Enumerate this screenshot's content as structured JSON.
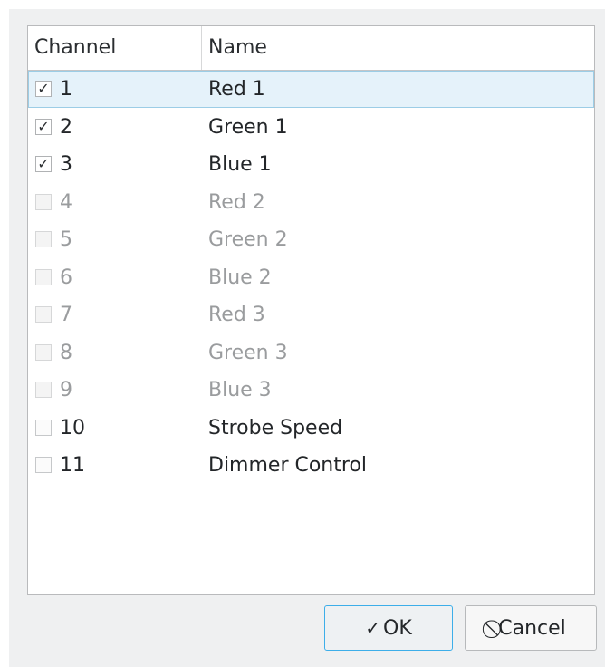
{
  "table": {
    "headers": [
      "Channel",
      "Name"
    ],
    "rows": [
      {
        "checked": true,
        "channel": "1",
        "name": "Red 1",
        "enabled": true,
        "selected": true
      },
      {
        "checked": true,
        "channel": "2",
        "name": "Green 1",
        "enabled": true,
        "selected": false
      },
      {
        "checked": true,
        "channel": "3",
        "name": "Blue 1",
        "enabled": true,
        "selected": false
      },
      {
        "checked": false,
        "channel": "4",
        "name": "Red 2",
        "enabled": false,
        "selected": false
      },
      {
        "checked": false,
        "channel": "5",
        "name": "Green 2",
        "enabled": false,
        "selected": false
      },
      {
        "checked": false,
        "channel": "6",
        "name": "Blue 2",
        "enabled": false,
        "selected": false
      },
      {
        "checked": false,
        "channel": "7",
        "name": "Red 3",
        "enabled": false,
        "selected": false
      },
      {
        "checked": false,
        "channel": "8",
        "name": "Green 3",
        "enabled": false,
        "selected": false
      },
      {
        "checked": false,
        "channel": "9",
        "name": "Blue 3",
        "enabled": false,
        "selected": false
      },
      {
        "checked": false,
        "channel": "10",
        "name": "Strobe Speed",
        "enabled": true,
        "selected": false
      },
      {
        "checked": false,
        "channel": "11",
        "name": "Dimmer Control",
        "enabled": true,
        "selected": false
      }
    ]
  },
  "buttons": {
    "ok_label": "OK",
    "ok_icon": "checkmark-icon",
    "cancel_label": "Cancel",
    "cancel_icon": "cancel-icon"
  },
  "colors": {
    "accent": "#3daee9",
    "selection_bg": "#e5f2fa",
    "disabled_text": "#9a9c9e"
  }
}
